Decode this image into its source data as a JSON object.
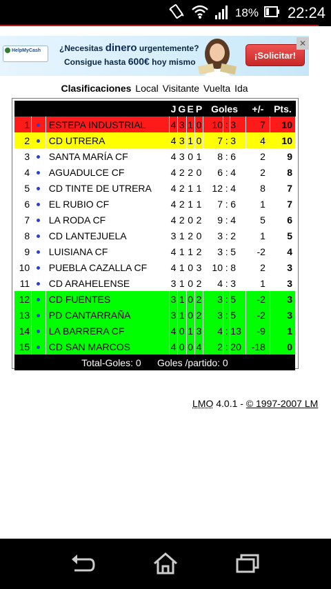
{
  "status_bar": {
    "battery_percent": "18%",
    "time": "22:24"
  },
  "ad": {
    "logo_text": "HelpMyCash",
    "line1_a": "¿Necesitas ",
    "line1_b": "dinero",
    "line1_c": " urgentemente?",
    "line2_a": "Consigue hasta ",
    "line2_b": "600€",
    "line2_c": " hoy mismo",
    "button_label": "¡Solicitar!",
    "close_label": "✕"
  },
  "tabs": {
    "active": "Clasificaciones",
    "local": "Local",
    "visitante": "Visitante",
    "vuelta": "Vuelta",
    "ida": "Ida"
  },
  "table": {
    "headers": {
      "j": "J",
      "g": "G",
      "e": "E",
      "p": "P",
      "goles": "Goles",
      "dif": "+/-",
      "pts": "Pts."
    },
    "rows": [
      {
        "rank": "1",
        "team": "ESTEPA INDUSTRIAL",
        "j": "4",
        "g": "3",
        "e": "1",
        "p": "0",
        "gf": "10",
        "ga": "3",
        "dif": "7",
        "pts": "10",
        "style": "red"
      },
      {
        "rank": "2",
        "team": "CD UTRERA",
        "j": "4",
        "g": "3",
        "e": "1",
        "p": "0",
        "gf": "7",
        "ga": "3",
        "dif": "4",
        "pts": "10",
        "style": "yellow"
      },
      {
        "rank": "3",
        "team": "SANTA MARÍA CF",
        "j": "4",
        "g": "3",
        "e": "0",
        "p": "1",
        "gf": "8",
        "ga": "6",
        "dif": "2",
        "pts": "9",
        "style": "white"
      },
      {
        "rank": "4",
        "team": "AGUADULCE CF",
        "j": "4",
        "g": "2",
        "e": "2",
        "p": "0",
        "gf": "6",
        "ga": "4",
        "dif": "2",
        "pts": "8",
        "style": "white"
      },
      {
        "rank": "5",
        "team": "CD TINTE DE UTRERA",
        "j": "4",
        "g": "2",
        "e": "1",
        "p": "1",
        "gf": "12",
        "ga": "4",
        "dif": "8",
        "pts": "7",
        "style": "white"
      },
      {
        "rank": "6",
        "team": "EL RUBIO CF",
        "j": "4",
        "g": "2",
        "e": "1",
        "p": "1",
        "gf": "7",
        "ga": "6",
        "dif": "1",
        "pts": "7",
        "style": "white"
      },
      {
        "rank": "7",
        "team": "LA RODA CF",
        "j": "4",
        "g": "2",
        "e": "0",
        "p": "2",
        "gf": "9",
        "ga": "4",
        "dif": "5",
        "pts": "6",
        "style": "white"
      },
      {
        "rank": "8",
        "team": "CD LANTEJUELA",
        "j": "3",
        "g": "1",
        "e": "2",
        "p": "0",
        "gf": "3",
        "ga": "2",
        "dif": "1",
        "pts": "5",
        "style": "white"
      },
      {
        "rank": "9",
        "team": "LUISIANA CF",
        "j": "4",
        "g": "1",
        "e": "1",
        "p": "2",
        "gf": "3",
        "ga": "5",
        "dif": "-2",
        "pts": "4",
        "style": "white"
      },
      {
        "rank": "10",
        "team": "PUEBLA CAZALLA CF",
        "j": "4",
        "g": "1",
        "e": "0",
        "p": "3",
        "gf": "10",
        "ga": "8",
        "dif": "2",
        "pts": "3",
        "style": "white"
      },
      {
        "rank": "11",
        "team": "CD ARAHELENSE",
        "j": "3",
        "g": "1",
        "e": "0",
        "p": "2",
        "gf": "4",
        "ga": "3",
        "dif": "1",
        "pts": "3",
        "style": "white"
      },
      {
        "rank": "12",
        "team": "CD FUENTES",
        "j": "3",
        "g": "1",
        "e": "0",
        "p": "2",
        "gf": "3",
        "ga": "5",
        "dif": "-2",
        "pts": "3",
        "style": "green"
      },
      {
        "rank": "13",
        "team": "PD CANTARRAÑA",
        "j": "3",
        "g": "1",
        "e": "0",
        "p": "2",
        "gf": "3",
        "ga": "5",
        "dif": "-2",
        "pts": "3",
        "style": "green"
      },
      {
        "rank": "14",
        "team": "LA BARRERA CF",
        "j": "4",
        "g": "0",
        "e": "1",
        "p": "3",
        "gf": "4",
        "ga": "13",
        "dif": "-9",
        "pts": "1",
        "style": "green"
      },
      {
        "rank": "15",
        "team": "CD SAN MARCOS",
        "j": "4",
        "g": "0",
        "e": "0",
        "p": "4",
        "gf": "2",
        "ga": "20",
        "dif": "-18",
        "pts": "0",
        "style": "green"
      }
    ],
    "goal_separator": ":",
    "footer": "Total-Goles: 0      Goles /partido: 0"
  },
  "credit": {
    "lmo": "LMO",
    "version": " 4.0.1 - ",
    "copyright": "© 1997-2007 LM"
  }
}
